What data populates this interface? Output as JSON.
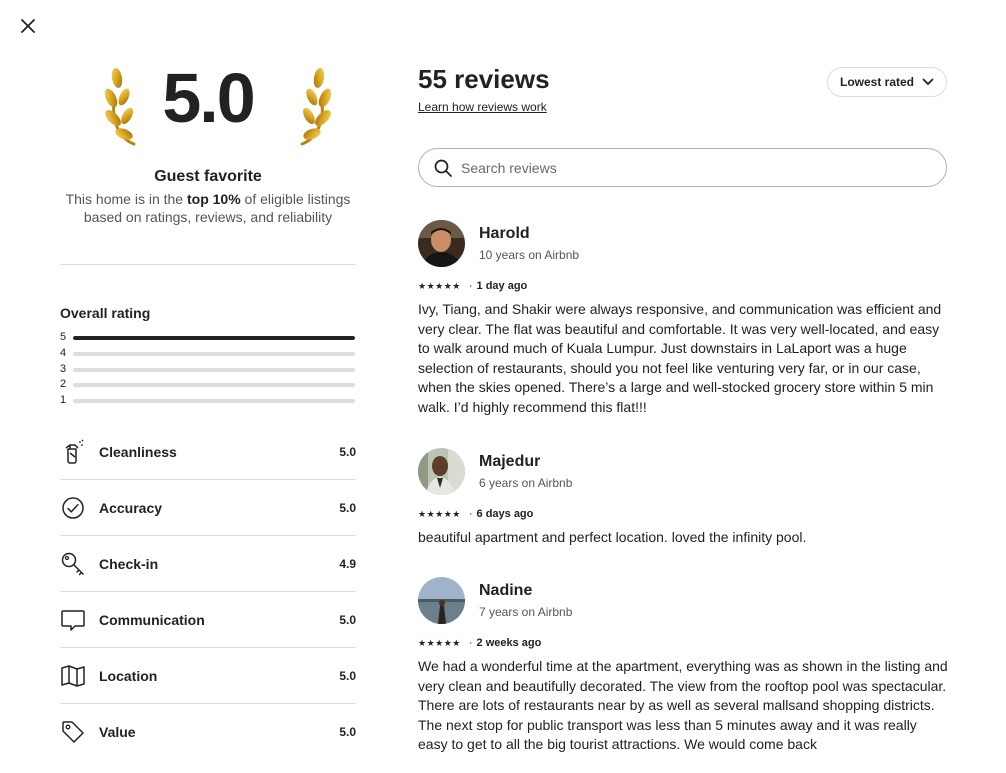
{
  "close": {
    "icon": "close-icon"
  },
  "summary": {
    "score": "5.0",
    "guest_favorite_title": "Guest favorite",
    "desc_prefix": "This home is in the ",
    "desc_bold": "top 10%",
    "desc_suffix": " of eligible listings based on ratings, reviews, and reliability"
  },
  "overall": {
    "title": "Overall rating",
    "bars": [
      {
        "label": "5",
        "fill": 1.0
      },
      {
        "label": "4",
        "fill": 0.0
      },
      {
        "label": "3",
        "fill": 0.0
      },
      {
        "label": "2",
        "fill": 0.0
      },
      {
        "label": "1",
        "fill": 0.0
      }
    ]
  },
  "categories": [
    {
      "label": "Cleanliness",
      "score": "5.0",
      "icon": "spray-bottle-icon"
    },
    {
      "label": "Accuracy",
      "score": "5.0",
      "icon": "check-circle-icon"
    },
    {
      "label": "Check-in",
      "score": "4.9",
      "icon": "key-icon"
    },
    {
      "label": "Communication",
      "score": "5.0",
      "icon": "chat-bubble-icon"
    },
    {
      "label": "Location",
      "score": "5.0",
      "icon": "map-icon"
    },
    {
      "label": "Value",
      "score": "5.0",
      "icon": "price-tag-icon"
    }
  ],
  "reviews_header": {
    "count_label": "55 reviews",
    "learn_link": "Learn how reviews work",
    "sort_label": "Lowest rated",
    "search_placeholder": "Search reviews"
  },
  "reviews": [
    {
      "name": "Harold",
      "tenure": "10 years on Airbnb",
      "stars": "★★★★★",
      "date": "1 day ago",
      "text": "Ivy, Tiang, and Shakir were always responsive, and communication was efficient and very clear. The flat was beautiful and comfortable. It was very well-located, and easy to walk around much of Kuala Lumpur. Just downstairs in LaLaport was a huge selection of restaurants, should you not feel like venturing very far, or in our case, when the skies opened. There’s a large and well-stocked grocery store within 5 min walk. I’d highly recommend this flat!!!"
    },
    {
      "name": "Majedur",
      "tenure": "6 years on Airbnb",
      "stars": "★★★★★",
      "date": "6 days ago",
      "text": "beautiful apartment and perfect location. loved the infinity pool."
    },
    {
      "name": "Nadine",
      "tenure": "7 years on Airbnb",
      "stars": "★★★★★",
      "date": "2 weeks ago",
      "text": "We had a wonderful time at the apartment, everything was as shown in the listing and very clean and beautifully decorated. The view from the rooftop pool was spectacular. There are lots of restaurants near by as well as several mallsand shopping districts. The next stop for public transport was less than 5 minutes away and it was really easy to get to all the big tourist attractions. We would come back"
    }
  ]
}
